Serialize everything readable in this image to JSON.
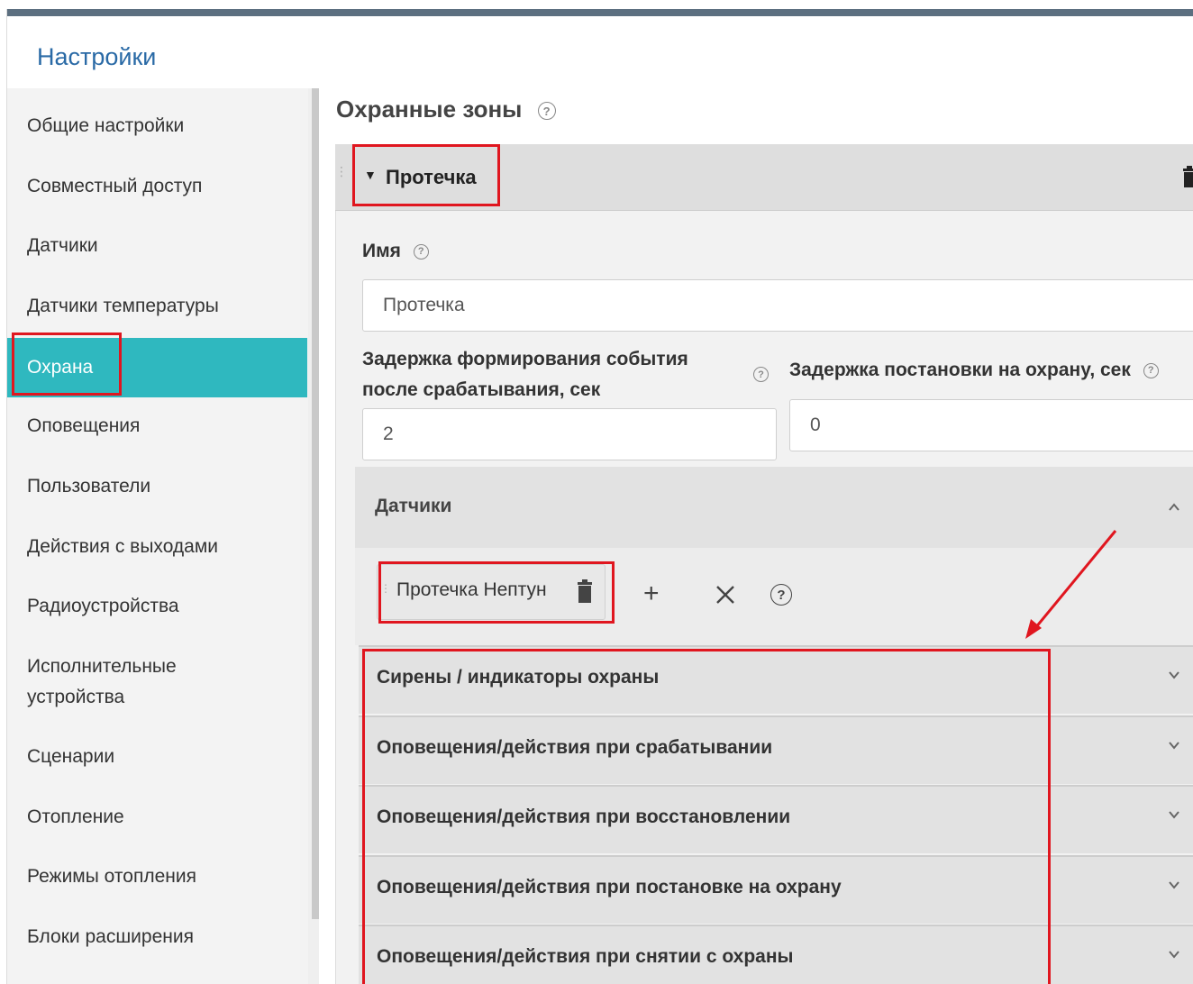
{
  "header": {
    "title": "Настройки"
  },
  "sidebar": {
    "items": [
      {
        "label": "Общие настройки"
      },
      {
        "label": "Совместный доступ"
      },
      {
        "label": "Датчики"
      },
      {
        "label": "Датчики температуры"
      },
      {
        "label": "Охрана",
        "active": true
      },
      {
        "label": "Оповещения"
      },
      {
        "label": "Пользователи"
      },
      {
        "label": "Действия с выходами"
      },
      {
        "label": "Радиоустройства"
      },
      {
        "label": "Исполнительные устройства"
      },
      {
        "label": "Сценарии"
      },
      {
        "label": "Отопление"
      },
      {
        "label": "Режимы отопления"
      },
      {
        "label": "Блоки расширения"
      }
    ]
  },
  "main": {
    "title": "Охранные зоны",
    "zone": {
      "name": "Протечка",
      "name_label": "Имя",
      "name_value": "Протечка",
      "event_delay_label": "Задержка формирования события после срабатывания, сек",
      "event_delay_value": "2",
      "arm_delay_label": "Задержка постановки на охрану, сек",
      "arm_delay_value": "0",
      "sensors": {
        "title": "Датчики",
        "items": [
          {
            "label": "Протечка Нептун"
          }
        ]
      },
      "sections": [
        {
          "label": "Сирены / индикаторы охраны"
        },
        {
          "label": "Оповещения/действия при срабатывании"
        },
        {
          "label": "Оповещения/действия при восстановлении"
        },
        {
          "label": "Оповещения/действия при постановке на охрану"
        },
        {
          "label": "Оповещения/действия при снятии с охраны"
        }
      ]
    }
  },
  "colors": {
    "accent": "#2fb8bf",
    "title_blue": "#2a6aa6",
    "highlight": "#e0161f"
  }
}
